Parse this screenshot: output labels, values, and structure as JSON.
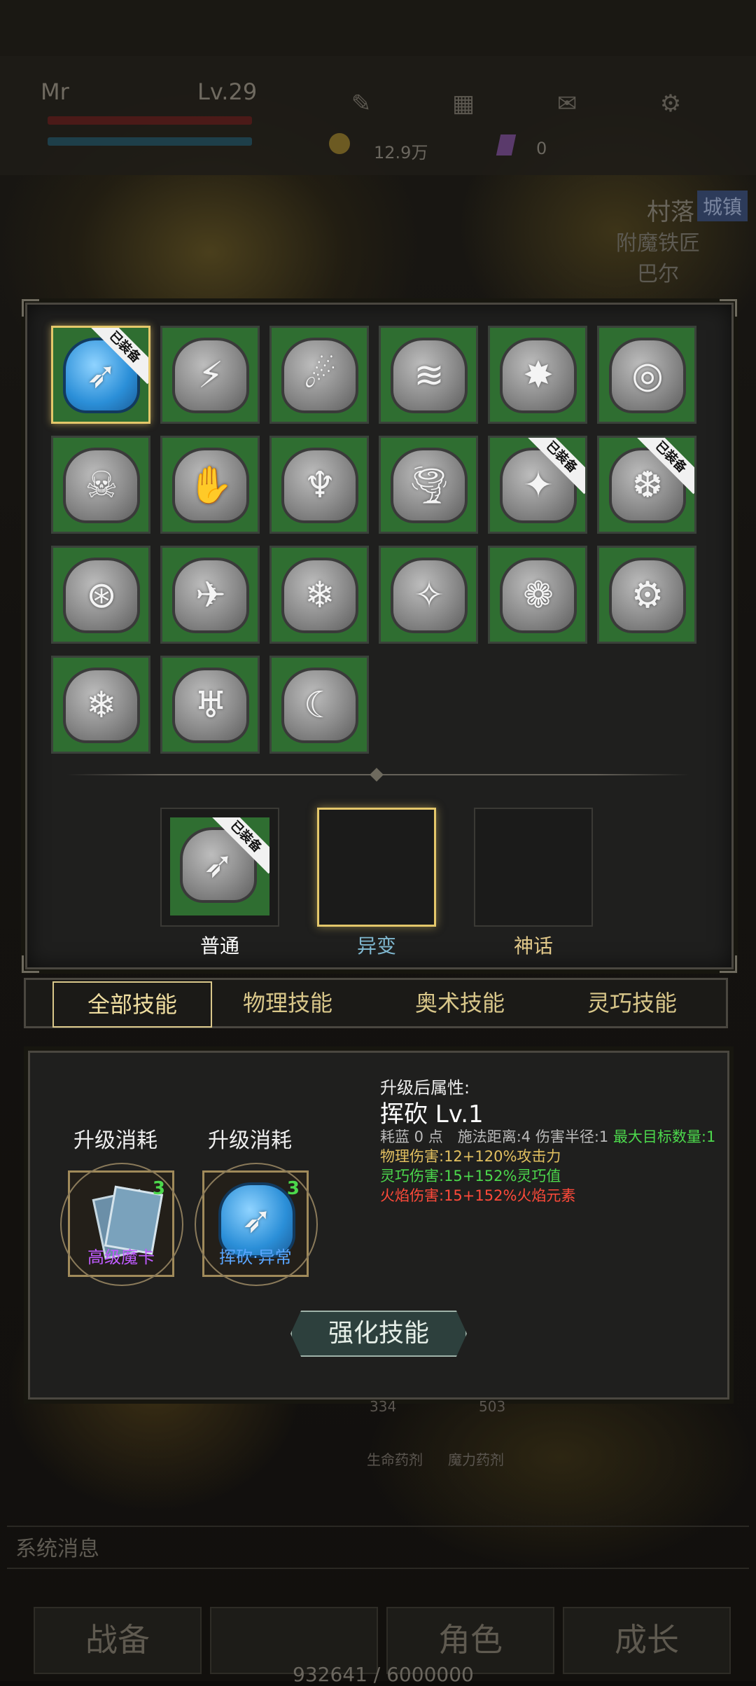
{
  "top": {
    "player_name": "Mr",
    "level": "Lv.29",
    "gold": "12.9万",
    "gems": "0",
    "town_tag": "城镇",
    "town_name": "村落",
    "npc_title": "附魔铁匠",
    "npc_name": "巴尔"
  },
  "skills": {
    "equipped_ribbon": "已装备",
    "tiles": [
      {
        "glyph": "➶",
        "equipped": true,
        "selected": true,
        "blue": true
      },
      {
        "glyph": "⚡",
        "equipped": false
      },
      {
        "glyph": "☄",
        "equipped": false
      },
      {
        "glyph": "≋",
        "equipped": false
      },
      {
        "glyph": "✸",
        "equipped": false
      },
      {
        "glyph": "◎",
        "equipped": false
      },
      {
        "glyph": "☠",
        "equipped": false
      },
      {
        "glyph": "✋",
        "equipped": false
      },
      {
        "glyph": "♆",
        "equipped": false
      },
      {
        "glyph": "🌪",
        "equipped": false
      },
      {
        "glyph": "✦",
        "equipped": true
      },
      {
        "glyph": "❆",
        "equipped": true
      },
      {
        "glyph": "⊛",
        "equipped": false
      },
      {
        "glyph": "✈",
        "equipped": false
      },
      {
        "glyph": "❄",
        "equipped": false
      },
      {
        "glyph": "✧",
        "equipped": false
      },
      {
        "glyph": "❁",
        "equipped": false
      },
      {
        "glyph": "⚙",
        "equipped": false
      },
      {
        "glyph": "❄",
        "equipped": false
      },
      {
        "glyph": "♅",
        "equipped": false
      },
      {
        "glyph": "☾",
        "equipped": false
      }
    ]
  },
  "slots": [
    {
      "label": "普通",
      "color": "#ffffff",
      "filled": true
    },
    {
      "label": "异变",
      "color": "#7fb7cf",
      "filled": false,
      "active": true
    },
    {
      "label": "神话",
      "color": "#e2c98a",
      "filled": false
    }
  ],
  "tabs": [
    "全部技能",
    "物理技能",
    "奥术技能",
    "灵巧技能"
  ],
  "upgrade": {
    "cost_title": "升级消耗",
    "costs": [
      {
        "name": "高级魔卡",
        "count": "3",
        "name_color": "#c05bff"
      },
      {
        "name": "挥砍·异常",
        "count": "3",
        "name_color": "#5aa6ff"
      }
    ],
    "after_title": "升级后属性:",
    "skill_name": "挥砍 Lv.1",
    "stats_line1_prefix": "耗蓝 0 点　施法距离:4 伤害半径:1 ",
    "stats_line1_suffix": "最大目标数量:1",
    "stat_physical": "物理伤害:12+120%攻击力",
    "stat_agility": "灵巧伤害:15+152%灵巧值",
    "stat_fire": "火焰伤害:15+152%火焰元素",
    "enhance_button": "强化技能"
  },
  "bottom": {
    "potion1_count": "334",
    "potion1_label": "生命药剂",
    "potion2_count": "503",
    "potion2_label": "魔力药剂",
    "system_message": "系统消息",
    "nav": [
      "战备",
      "",
      "角色",
      "成长"
    ],
    "xp": "932641 / 6000000"
  }
}
